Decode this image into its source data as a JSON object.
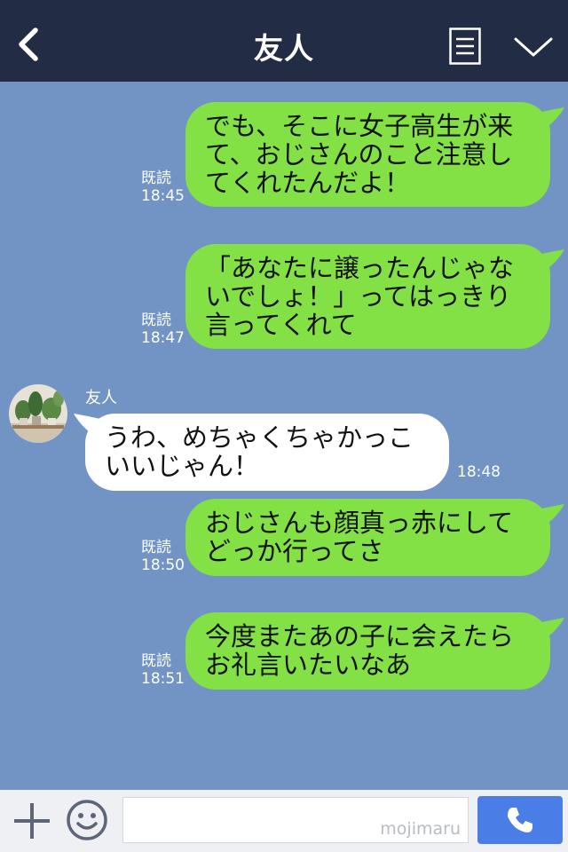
{
  "header": {
    "title": "友人"
  },
  "sender_name": "友人",
  "read_label": "既読",
  "messages": [
    {
      "side": "me",
      "text": "でも、そこに女子高生が来て、おじさんのこと注意してくれたんだよ！",
      "lines": [
        "でも、そこに女子高生が来",
        "て、おじさんのこと注意し",
        "てくれたんだよ！"
      ],
      "time": "18:45",
      "read": true
    },
    {
      "side": "me",
      "text": "「あなたに譲ったんじゃないでしょ！」ってはっきり言ってくれて",
      "lines": [
        "「あなたに譲ったんじゃな",
        "いでしょ！」ってはっきり",
        "言ってくれて"
      ],
      "time": "18:47",
      "read": true
    },
    {
      "side": "them",
      "text": "うわ、めちゃくちゃかっこいいじゃん！",
      "lines": [
        "うわ、めちゃくちゃかっこ",
        "いいじゃん！"
      ],
      "time": "18:48"
    },
    {
      "side": "me",
      "text": "おじさんも顔真っ赤にしてどっか行ってさ",
      "lines": [
        "おじさんも顔真っ赤にして",
        "どっか行ってさ"
      ],
      "time": "18:50",
      "read": true
    },
    {
      "side": "me",
      "text": "今度またあの子に会えたらお礼言いたいなあ",
      "lines": [
        "今度またあの子に会えたら",
        "お礼言いたいなあ"
      ],
      "time": "18:51",
      "read": true
    }
  ],
  "input": {
    "value": "",
    "watermark": "mojimaru"
  },
  "colors": {
    "header": "#232c45",
    "chat_bg": "#7294c4",
    "my_bubble": "#83e045",
    "their_bubble": "#ffffff",
    "send_button": "#4b7de6"
  },
  "icons": {
    "back": "chevron-left-icon",
    "menu": "notes-icon",
    "collapse": "chevron-down-icon",
    "plus": "plus-icon",
    "emoji": "smiley-icon",
    "send": "phone-icon"
  }
}
